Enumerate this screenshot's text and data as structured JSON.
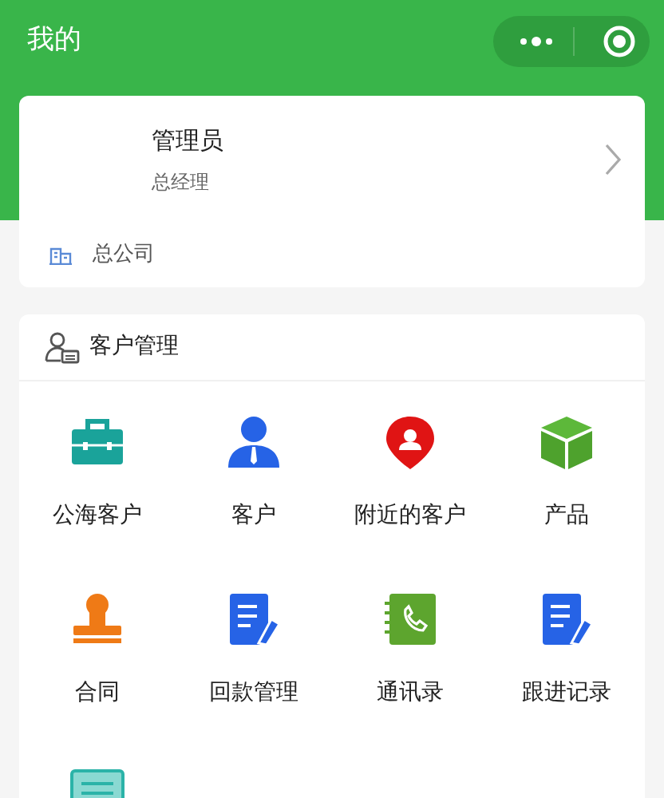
{
  "header": {
    "title": "我的"
  },
  "profile": {
    "name": "管理员",
    "role": "总经理",
    "company": "总公司"
  },
  "section": {
    "title": "客户管理",
    "items": [
      {
        "kind": "briefcase",
        "label": "公海客户"
      },
      {
        "kind": "person",
        "label": "客户"
      },
      {
        "kind": "pin",
        "label": "附近的客户"
      },
      {
        "kind": "cube",
        "label": "产品"
      },
      {
        "kind": "stamp",
        "label": "合同"
      },
      {
        "kind": "document",
        "label": "回款管理"
      },
      {
        "kind": "phonebook",
        "label": "通讯录"
      },
      {
        "kind": "document",
        "label": "跟进记录"
      },
      {
        "kind": "list"
      }
    ]
  }
}
